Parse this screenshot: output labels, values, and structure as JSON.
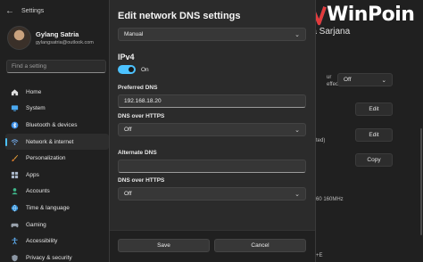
{
  "app": {
    "title": "Settings",
    "back_icon": "back-arrow-icon"
  },
  "profile": {
    "name": "Gylang Satria",
    "email": "gylangsatria@outlook.com"
  },
  "search": {
    "placeholder": "Find a setting"
  },
  "sidebar": {
    "items": [
      {
        "label": "Home",
        "icon": "home-icon",
        "active": false
      },
      {
        "label": "System",
        "icon": "system-icon",
        "active": false
      },
      {
        "label": "Bluetooth & devices",
        "icon": "bluetooth-icon",
        "active": false
      },
      {
        "label": "Network & internet",
        "icon": "network-icon",
        "active": true
      },
      {
        "label": "Personalization",
        "icon": "brush-icon",
        "active": false
      },
      {
        "label": "Apps",
        "icon": "apps-icon",
        "active": false
      },
      {
        "label": "Accounts",
        "icon": "accounts-icon",
        "active": false
      },
      {
        "label": "Time & language",
        "icon": "globe-icon",
        "active": false
      },
      {
        "label": "Gaming",
        "icon": "gaming-icon",
        "active": false
      },
      {
        "label": "Accessibility",
        "icon": "accessibility-icon",
        "active": false
      },
      {
        "label": "Privacy & security",
        "icon": "shield-icon",
        "active": false
      }
    ]
  },
  "background_content": {
    "setting_fragment_1": "ur",
    "setting_fragment_2": "effect",
    "dropdown_value": "Off",
    "edit_button_1": "Edit",
    "fragment_ted": "ted)",
    "edit_button_2": "Edit",
    "copy_button": "Copy",
    "fragment_mhz": "60 160MHz",
    "fragment_bottom": "+E"
  },
  "watermark": {
    "brand": "WinPoin",
    "sub": "ra Sarjana"
  },
  "dialog": {
    "title": "Edit network DNS settings",
    "mode_value": "Manual",
    "section_title": "IPv4",
    "toggle_state_label": "On",
    "preferred_dns_label": "Preferred DNS",
    "preferred_dns_value": "192.168.18.20",
    "doh_label_1": "DNS over HTTPS",
    "doh_value_1": "Off",
    "alternate_dns_label": "Alternate DNS",
    "alternate_dns_value": "",
    "doh_label_2": "DNS over HTTPS",
    "doh_value_2": "Off",
    "save_label": "Save",
    "cancel_label": "Cancel"
  },
  "colors": {
    "accent": "#4cc2ff",
    "background": "#202020",
    "dialog": "#2b2b2b"
  }
}
